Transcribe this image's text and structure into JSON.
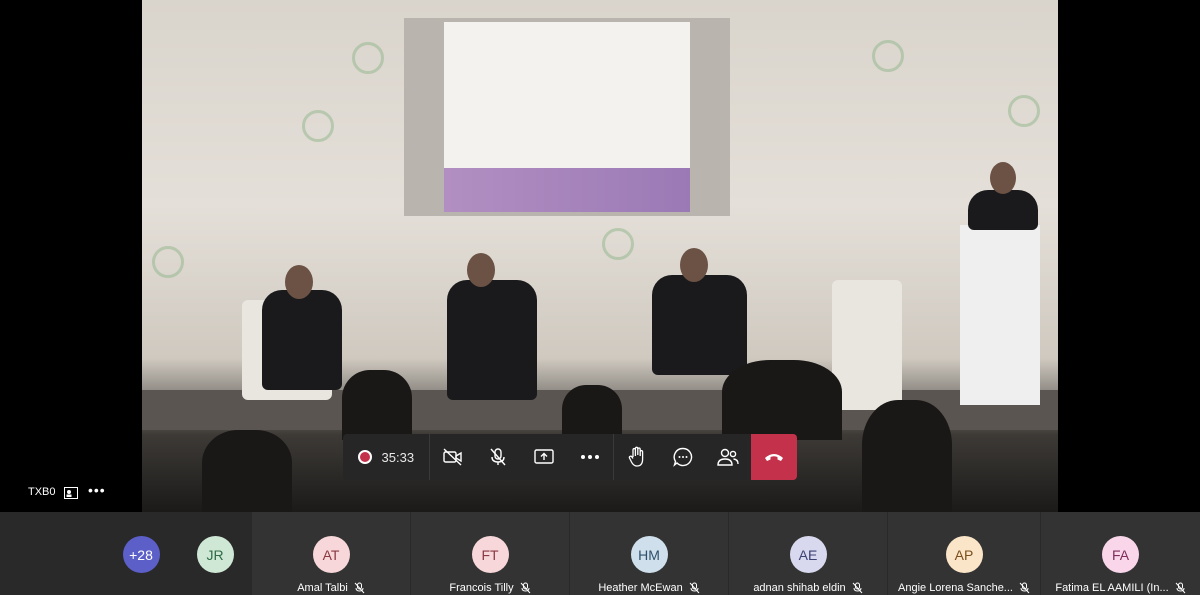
{
  "meeting": {
    "self_label": "TXB0",
    "timer": "35:33"
  },
  "toolbar": {
    "buttons": [
      "camera-off",
      "mic-off",
      "share",
      "more",
      "raise-hand",
      "chat",
      "people",
      "leave"
    ]
  },
  "participants": {
    "overflow_count": "+28",
    "overflow_color": "#5b5fc7",
    "tiles": [
      {
        "initials": "JR",
        "name": "",
        "avatar_bg": "#cfe8d6",
        "avatar_fg": "#2f6b45"
      },
      {
        "initials": "AT",
        "name": "Amal Talbi",
        "avatar_bg": "#f7d7d9",
        "avatar_fg": "#8a3a42"
      },
      {
        "initials": "FT",
        "name": "Francois Tilly",
        "avatar_bg": "#f7d7d9",
        "avatar_fg": "#8a3a42"
      },
      {
        "initials": "HM",
        "name": "Heather McEwan",
        "avatar_bg": "#cfe0ec",
        "avatar_fg": "#2f4f6b"
      },
      {
        "initials": "AE",
        "name": "adnan shihab eldin",
        "avatar_bg": "#d8d9ee",
        "avatar_fg": "#3e4273"
      },
      {
        "initials": "AP",
        "name": "Angie Lorena Sanche...",
        "avatar_bg": "#fbe5c8",
        "avatar_fg": "#7a4f1d"
      },
      {
        "initials": "FA",
        "name": "Fatima EL AAMILI (In...",
        "avatar_bg": "#f9d6ea",
        "avatar_fg": "#7d2e5c"
      }
    ]
  },
  "colors": {
    "leave": "#c4314b",
    "record": "#c4314b",
    "toolbar_bg": "#262626"
  }
}
